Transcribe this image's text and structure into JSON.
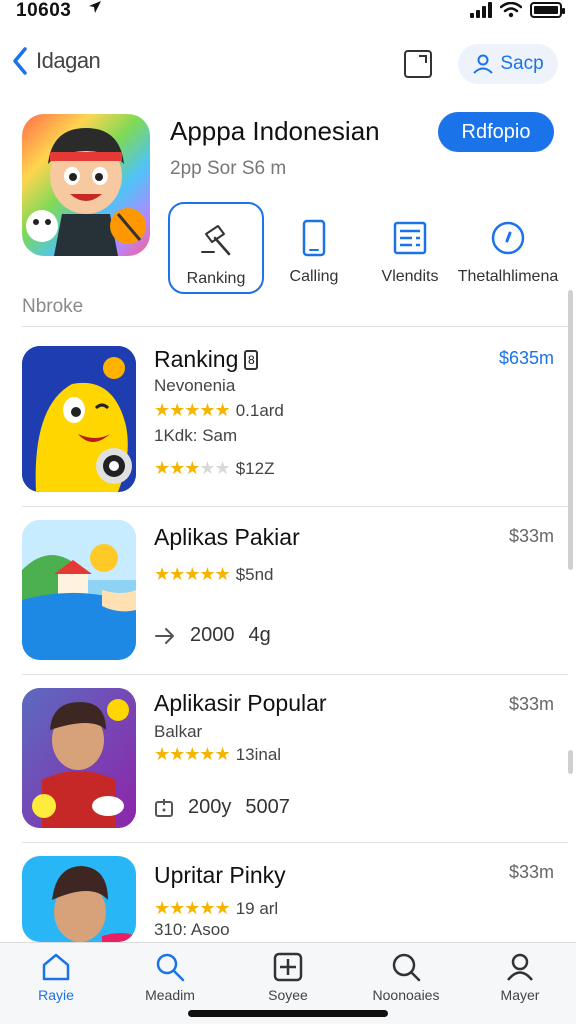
{
  "status_bar": {
    "time": "10603"
  },
  "nav": {
    "back_label": "Idagan",
    "account_label": "Sacp"
  },
  "app": {
    "title": "Apppa Indonesian",
    "subtitle": "2pp Sor  S6 m",
    "primary_button": "Rdfopio"
  },
  "actions": [
    {
      "label": "Ranking",
      "icon": "hammer-icon",
      "selected": true
    },
    {
      "label": "Calling",
      "icon": "phone-icon"
    },
    {
      "label": "Vlendits",
      "icon": "list-icon"
    },
    {
      "label": "Thetalhlimena",
      "icon": "compass-icon"
    }
  ],
  "section": {
    "label": "Nbroke"
  },
  "list": [
    {
      "title": "Ranking",
      "badge": "8",
      "subtitle": "Nevonenia",
      "rating": 4.5,
      "rating_text": "0.1ard",
      "line3": "1Kdk: Sam",
      "rating2": 3.5,
      "rating2_text": "$12Z",
      "price": "$635m"
    },
    {
      "title": "Aplikas Pakiar",
      "rating": 5,
      "rating_text": "$5nd",
      "stat_icon": "share-icon",
      "stat_a": "2000",
      "stat_b": "4g",
      "price": "$33m"
    },
    {
      "title": "Aplikasir Popular",
      "subtitle": "Balkar",
      "rating": 5,
      "rating_text": "13inal",
      "stat_icon": "download-icon",
      "stat_a": "200y",
      "stat_b": "5007",
      "price": "$33m"
    },
    {
      "title": "Upritar Pinky",
      "rating": 5,
      "rating_text": "19 arl",
      "line3": "310: Asoo",
      "price": "$33m"
    }
  ],
  "tabs": [
    {
      "label": "Rayie",
      "icon": "home-icon",
      "active": true
    },
    {
      "label": "Meadim",
      "icon": "search-icon"
    },
    {
      "label": "Soyee",
      "icon": "add-icon"
    },
    {
      "label": "Noonoaies",
      "icon": "search-icon"
    },
    {
      "label": "Mayer",
      "icon": "person-icon"
    }
  ],
  "colors": {
    "accent": "#1a73e8",
    "star": "#f5b400"
  }
}
